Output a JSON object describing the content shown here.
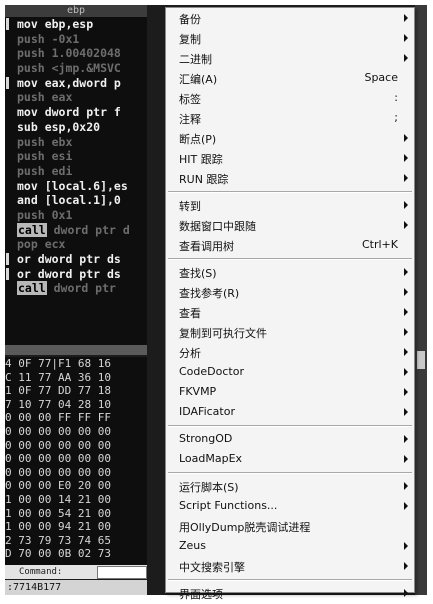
{
  "disasm": {
    "header": "ebp",
    "lines": [
      {
        "text": "mov ebp,esp",
        "tone": "bright",
        "hl": "",
        "marker": true
      },
      {
        "text": "push -0x1",
        "tone": "dim",
        "hl": "",
        "marker": false
      },
      {
        "text": "push 1.00402048",
        "tone": "dim",
        "hl": "",
        "marker": false
      },
      {
        "text": "push <jmp.&MSVC",
        "tone": "dim",
        "hl": "",
        "marker": false
      },
      {
        "text": "mov eax,dword p",
        "tone": "bright",
        "hl": "",
        "marker": true
      },
      {
        "text": "push eax",
        "tone": "dim",
        "hl": "",
        "marker": false
      },
      {
        "text": "mov dword ptr f",
        "tone": "bright",
        "hl": "",
        "marker": false
      },
      {
        "text": "sub esp,0x20",
        "tone": "bright",
        "hl": "",
        "marker": false
      },
      {
        "text": "push ebx",
        "tone": "dim",
        "hl": "",
        "marker": false
      },
      {
        "text": "push esi",
        "tone": "dim",
        "hl": "",
        "marker": false
      },
      {
        "text": "push edi",
        "tone": "dim",
        "hl": "",
        "marker": false
      },
      {
        "text": "mov [local.6],es",
        "tone": "bright",
        "hl": "",
        "marker": false
      },
      {
        "text": "and [local.1],0",
        "tone": "bright",
        "hl": "",
        "marker": false
      },
      {
        "text": "push 0x1",
        "tone": "dim",
        "hl": "",
        "marker": false
      },
      {
        "text": " dword ptr d",
        "tone": "dim",
        "hl": "call",
        "marker": false
      },
      {
        "text": "pop ecx",
        "tone": "dim",
        "hl": "",
        "marker": false
      },
      {
        "text": "or dword ptr ds",
        "tone": "bright",
        "hl": "",
        "marker": true
      },
      {
        "text": "or dword ptr ds",
        "tone": "bright",
        "hl": "",
        "marker": true
      },
      {
        "text": " dword ptr",
        "tone": "dim",
        "hl": "call",
        "marker": false
      }
    ]
  },
  "dump": {
    "rows": [
      "4 0F 77|F1 68 16",
      "C 11 77 AA 36 10",
      "1 0F 77 DD 77 18",
      "7 10 77 04 28 10",
      "0 00 00 FF FF FF",
      "0 00 00 00 00 00",
      "0 00 00 00 00 00",
      "0 00 00 00 00 00",
      "0 00 00 00 00 00",
      "0 00 00 E0 20 00",
      "1 00 00 14 21 00",
      "1 00 00 54 21 00",
      "1 00 00 94 21 00",
      "2 73 79 73 74 65",
      "D 70 00 0B 02 73"
    ]
  },
  "command_label": "Command:",
  "status_text": ":7714B177",
  "menu": {
    "groups": [
      [
        {
          "label": "备份",
          "shortcut": "",
          "arrow": true
        },
        {
          "label": "复制",
          "shortcut": "",
          "arrow": true
        },
        {
          "label": "二进制",
          "shortcut": "",
          "arrow": true
        },
        {
          "label": "汇编(A)",
          "shortcut": "Space",
          "arrow": false
        },
        {
          "label": "标签",
          "shortcut": ":",
          "arrow": false
        },
        {
          "label": "注释",
          "shortcut": ";",
          "arrow": false
        },
        {
          "label": "断点(P)",
          "shortcut": "",
          "arrow": true
        },
        {
          "label": "HIT 跟踪",
          "shortcut": "",
          "arrow": true
        },
        {
          "label": "RUN 跟踪",
          "shortcut": "",
          "arrow": true
        }
      ],
      [
        {
          "label": "转到",
          "shortcut": "",
          "arrow": true
        },
        {
          "label": "数据窗口中跟随",
          "shortcut": "",
          "arrow": true
        },
        {
          "label": "查看调用树",
          "shortcut": "Ctrl+K",
          "arrow": false
        }
      ],
      [
        {
          "label": "查找(S)",
          "shortcut": "",
          "arrow": true
        },
        {
          "label": "查找参考(R)",
          "shortcut": "",
          "arrow": true
        },
        {
          "label": "查看",
          "shortcut": "",
          "arrow": true
        },
        {
          "label": "复制到可执行文件",
          "shortcut": "",
          "arrow": true
        },
        {
          "label": "分析",
          "shortcut": "",
          "arrow": true
        },
        {
          "label": "CodeDoctor",
          "shortcut": "",
          "arrow": true
        },
        {
          "label": "FKVMP",
          "shortcut": "",
          "arrow": true
        },
        {
          "label": "IDAFicator",
          "shortcut": "",
          "arrow": true
        }
      ],
      [
        {
          "label": "StrongOD",
          "shortcut": "",
          "arrow": true
        },
        {
          "label": "LoadMapEx",
          "shortcut": "",
          "arrow": true
        }
      ],
      [
        {
          "label": "运行脚本(S)",
          "shortcut": "",
          "arrow": true
        },
        {
          "label": "Script Functions...",
          "shortcut": "",
          "arrow": true
        },
        {
          "label": "用OllyDump脱壳调试进程",
          "shortcut": "",
          "arrow": false
        },
        {
          "label": "Zeus",
          "shortcut": "",
          "arrow": true
        },
        {
          "label": "中文搜索引擎",
          "shortcut": "",
          "arrow": true
        }
      ],
      [
        {
          "label": "界面选项",
          "shortcut": "",
          "arrow": true
        }
      ]
    ]
  }
}
